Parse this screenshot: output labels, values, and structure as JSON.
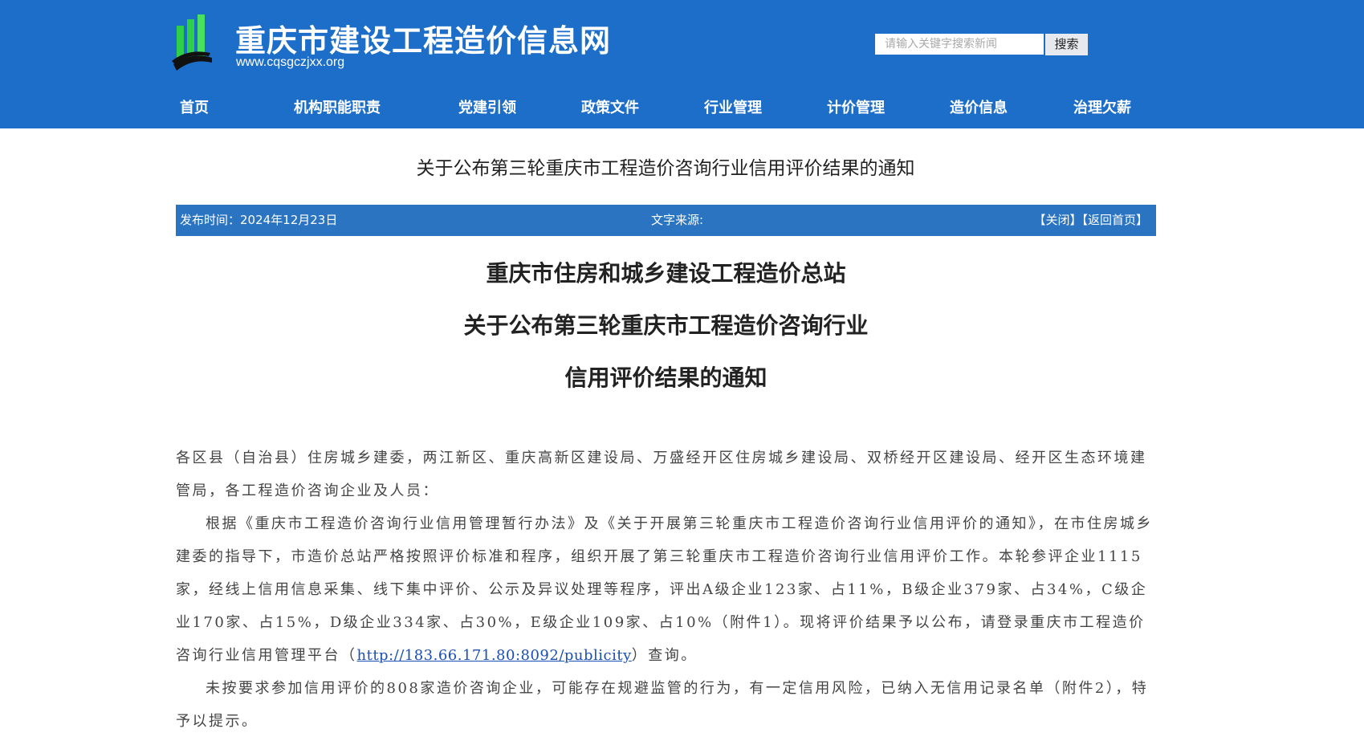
{
  "site": {
    "title": "重庆市建设工程造价信息网",
    "url": "www.cqsgczjxx.org"
  },
  "search": {
    "placeholder": "请输入关键字搜索新闻",
    "button_label": "搜索"
  },
  "nav": {
    "items": [
      {
        "label": "首页"
      },
      {
        "label": "机构职能职责"
      },
      {
        "label": "党建引领"
      },
      {
        "label": "政策文件"
      },
      {
        "label": "行业管理"
      },
      {
        "label": "计价管理"
      },
      {
        "label": "造价信息"
      },
      {
        "label": "治理欠薪"
      }
    ]
  },
  "article": {
    "title": "关于公布第三轮重庆市工程造价咨询行业信用评价结果的通知",
    "publish_time": "发布时间：2024年12月23日",
    "source": "文字来源:",
    "close_label": "【关闭】",
    "home_label": "【返回首页】",
    "heading_lines": [
      "重庆市住房和城乡建设工程造价总站",
      "关于公布第三轮重庆市工程造价咨询行业",
      "信用评价结果的通知"
    ],
    "salutation": "各区县（自治县）住房城乡建委，两江新区、重庆高新区建设局、万盛经开区住房城乡建设局、双桥经开区建设局、经开区生态环境建管局，各工程造价咨询企业及人员：",
    "paragraph1_prefix": "根据《重庆市工程造价咨询行业信用管理暂行办法》及《关于开展第三轮重庆市工程造价咨询行业信用评价的通知》，在市住房城乡建委的指导下，市造价总站严格按照评价标准和程序，组织开展了第三轮重庆市工程造价咨询行业信用评价工作。本轮参评企业1115家，经线上信用信息采集、线下集中评价、公示及异议处理等程序，评出A级企业123家、占11%，B级企业379家、占34%，C级企业170家、占15%，D级企业334家、占30%，E级企业109家、占10%（附件1）。现将评价结果予以公布，请登录重庆市工程造价咨询行业信用管理平台（",
    "platform_link": "http://183.66.171.80:8092/publicity",
    "paragraph1_suffix": "）查询。",
    "paragraph2": "未按要求参加信用评价的808家造价咨询企业，可能存在规避监管的行为，有一定信用风险，已纳入无信用记录名单（附件2），特予以提示。"
  },
  "colors": {
    "header_blue": "#1c6ec9",
    "info_bar_blue": "#2a74c2",
    "logo_green": "#2fcf4a",
    "link_blue": "#1a4fb5"
  }
}
